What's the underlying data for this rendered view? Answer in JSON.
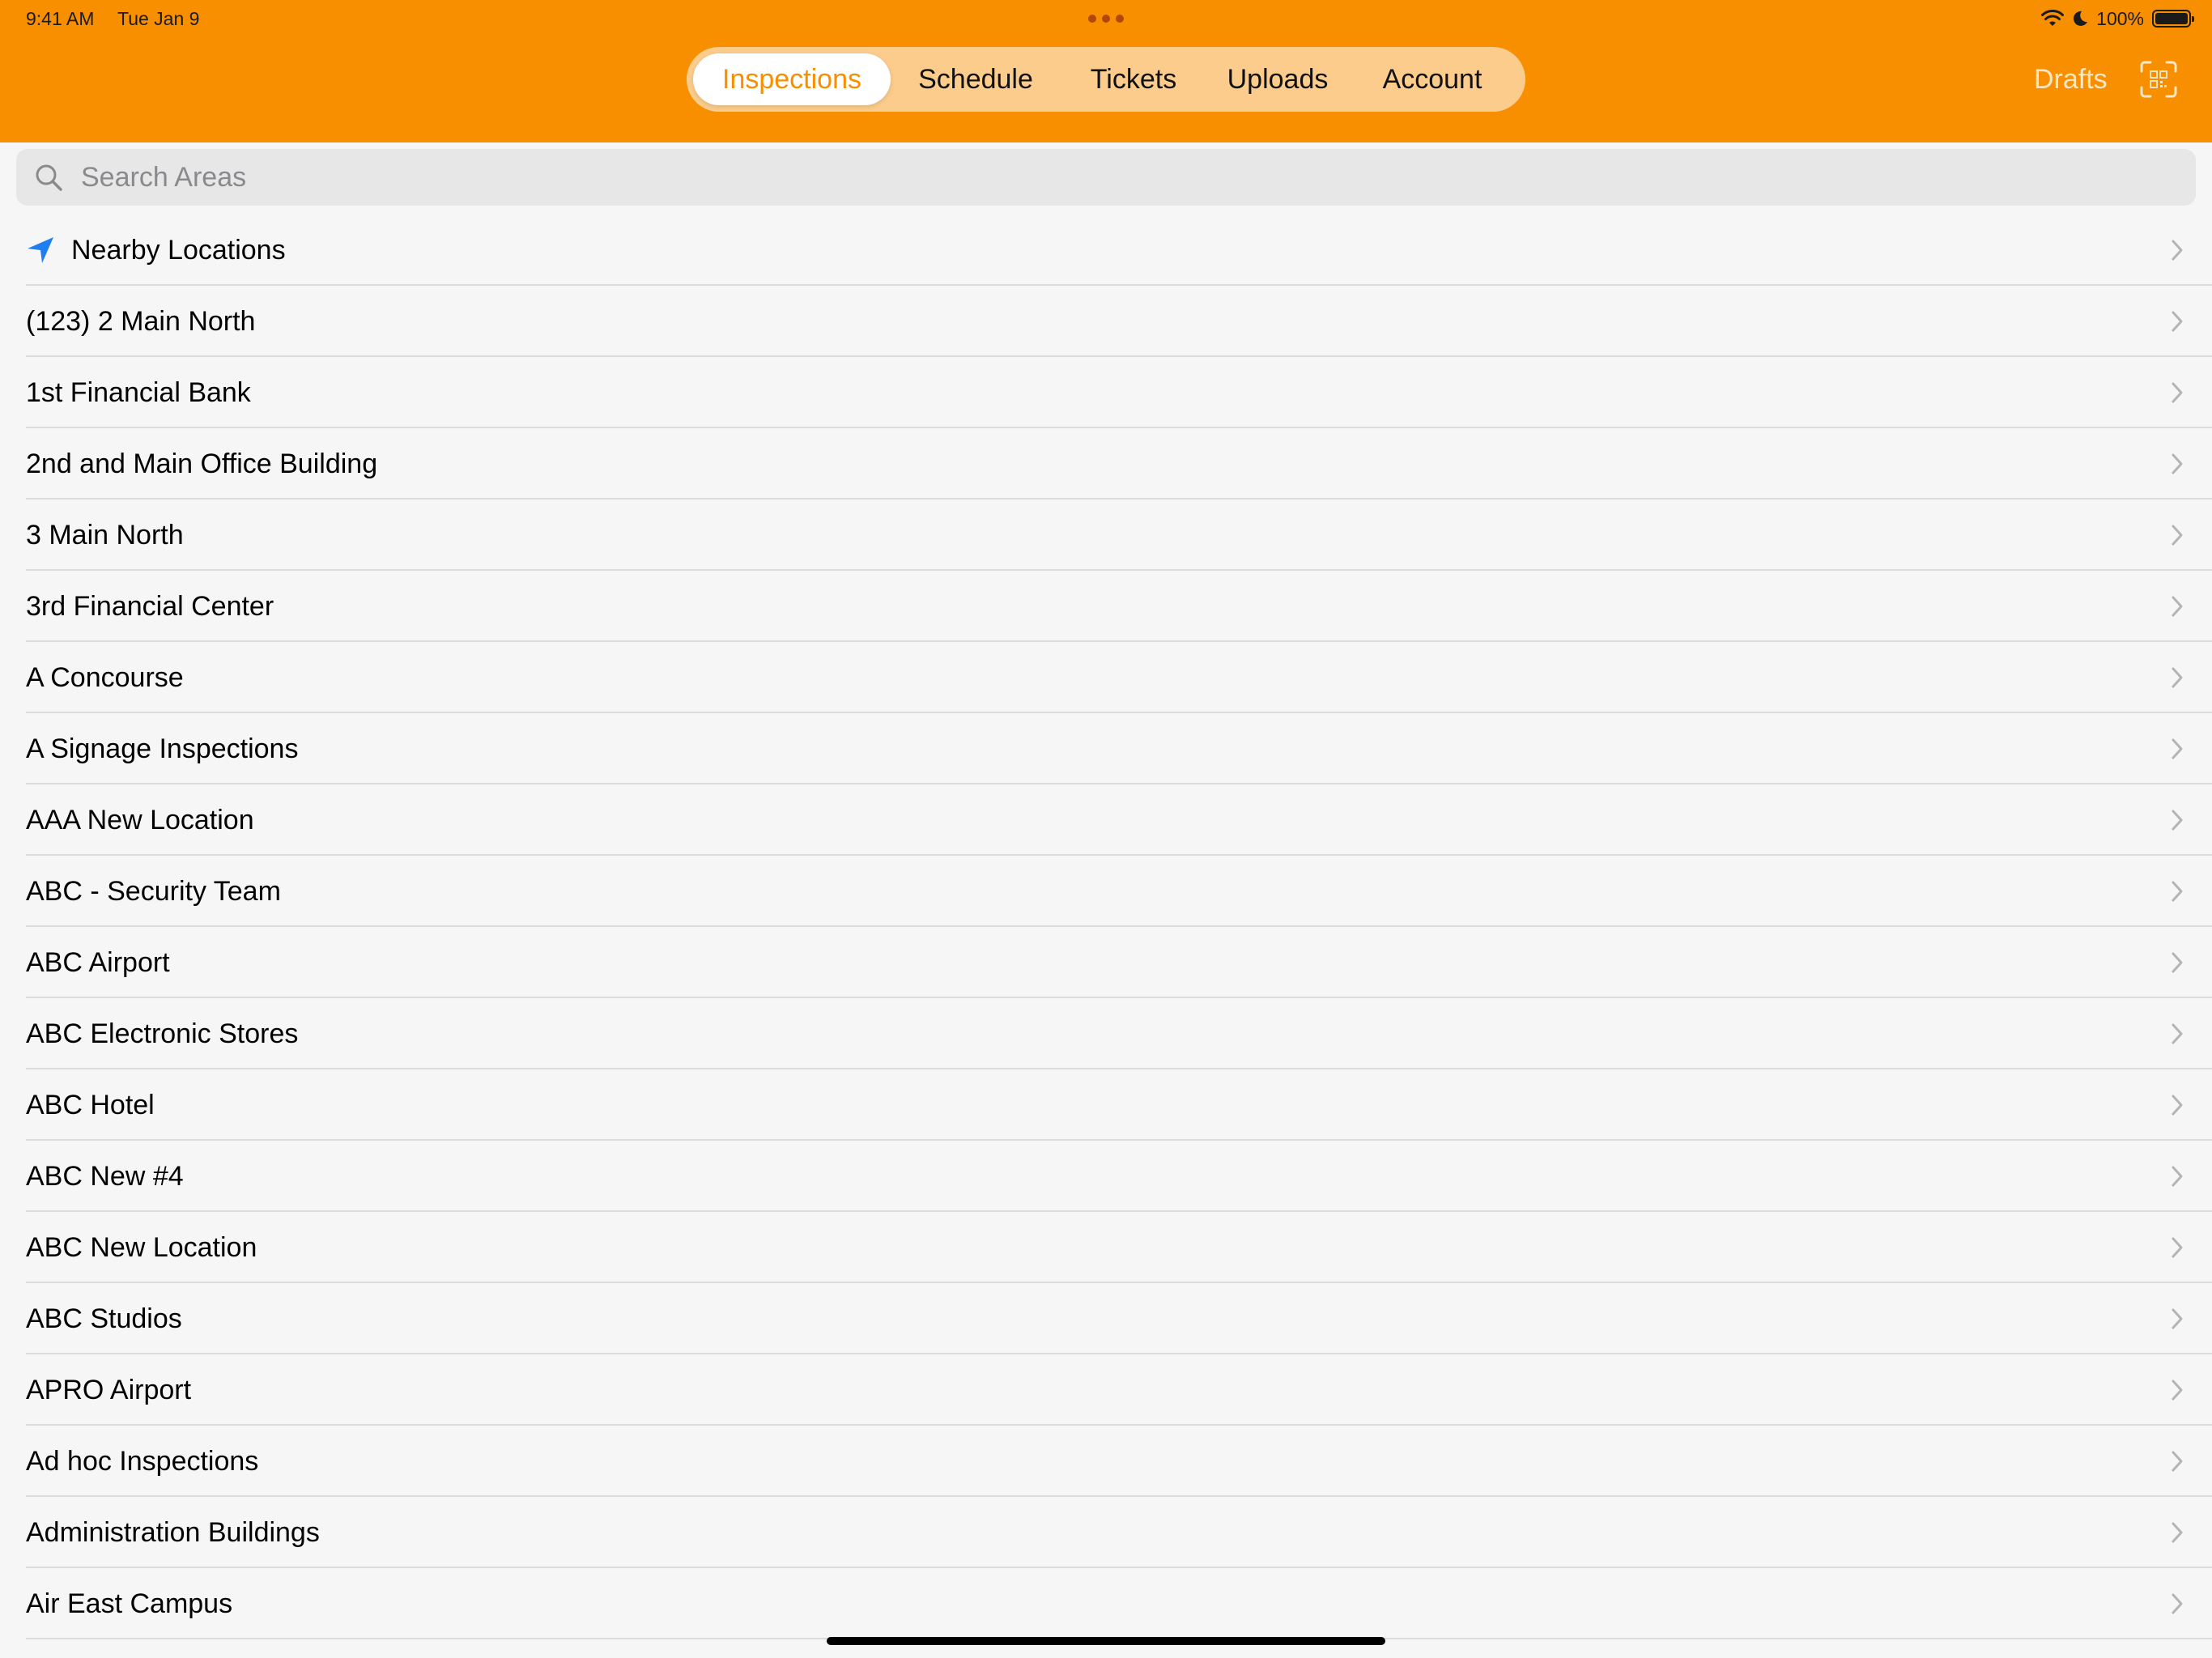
{
  "status_bar": {
    "time": "9:41 AM",
    "date": "Tue Jan 9",
    "battery": "100%"
  },
  "tabs": [
    {
      "label": "Inspections",
      "active": true
    },
    {
      "label": "Schedule",
      "active": false
    },
    {
      "label": "Tickets",
      "active": false
    },
    {
      "label": "Uploads",
      "active": false
    },
    {
      "label": "Account",
      "active": false
    }
  ],
  "header_actions": {
    "drafts_label": "Drafts",
    "qr_icon": "qr-scan-icon"
  },
  "search": {
    "placeholder": "Search Areas",
    "value": ""
  },
  "nearby": {
    "label": "Nearby Locations",
    "icon": "location-arrow-icon"
  },
  "locations": [
    "(123) 2 Main North",
    "1st Financial Bank",
    "2nd and Main Office Building",
    "3 Main North",
    "3rd Financial Center",
    "A Concourse",
    "A Signage Inspections",
    "AAA New Location",
    "ABC - Security Team",
    "ABC Airport",
    "ABC Electronic Stores",
    "ABC Hotel",
    "ABC New #4",
    "ABC New Location",
    "ABC Studios",
    "APRO Airport",
    "Ad hoc Inspections",
    "Administration Buildings",
    "Air East Campus"
  ],
  "colors": {
    "accent": "#f78f00",
    "location_icon": "#1f7ff0",
    "chevron": "#b4b4b6"
  }
}
